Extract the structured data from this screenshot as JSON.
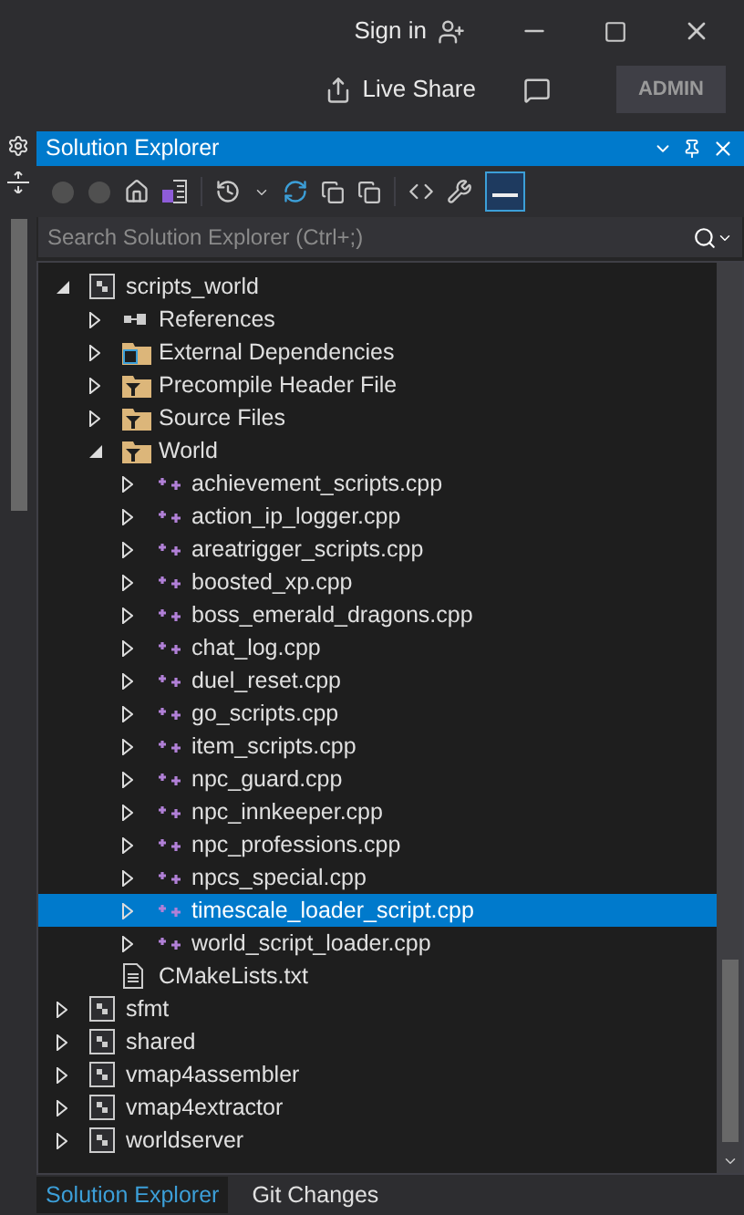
{
  "title_bar": {
    "sign_in": "Sign in",
    "live_share": "Live Share",
    "badge": "ADMIN"
  },
  "panel": {
    "title": "Solution Explorer",
    "search": {
      "placeholder": "Search Solution Explorer (Ctrl+;)"
    }
  },
  "tree": [
    {
      "label": "scripts_world",
      "kind": "project",
      "expanded": true,
      "selected": false,
      "children": [
        {
          "label": "References",
          "kind": "references",
          "expanded": false,
          "selected": false
        },
        {
          "label": "External Dependencies",
          "kind": "external",
          "expanded": false,
          "selected": false
        },
        {
          "label": "Precompile Header File",
          "kind": "filter",
          "expanded": false,
          "selected": false
        },
        {
          "label": "Source Files",
          "kind": "filter",
          "expanded": false,
          "selected": false
        },
        {
          "label": "World",
          "kind": "filter",
          "expanded": true,
          "selected": false,
          "children": [
            {
              "label": "achievement_scripts.cpp",
              "kind": "cpp",
              "expanded": false,
              "selected": false
            },
            {
              "label": "action_ip_logger.cpp",
              "kind": "cpp",
              "expanded": false,
              "selected": false
            },
            {
              "label": "areatrigger_scripts.cpp",
              "kind": "cpp",
              "expanded": false,
              "selected": false
            },
            {
              "label": "boosted_xp.cpp",
              "kind": "cpp",
              "expanded": false,
              "selected": false
            },
            {
              "label": "boss_emerald_dragons.cpp",
              "kind": "cpp",
              "expanded": false,
              "selected": false
            },
            {
              "label": "chat_log.cpp",
              "kind": "cpp",
              "expanded": false,
              "selected": false
            },
            {
              "label": "duel_reset.cpp",
              "kind": "cpp",
              "expanded": false,
              "selected": false
            },
            {
              "label": "go_scripts.cpp",
              "kind": "cpp",
              "expanded": false,
              "selected": false
            },
            {
              "label": "item_scripts.cpp",
              "kind": "cpp",
              "expanded": false,
              "selected": false
            },
            {
              "label": "npc_guard.cpp",
              "kind": "cpp",
              "expanded": false,
              "selected": false
            },
            {
              "label": "npc_innkeeper.cpp",
              "kind": "cpp",
              "expanded": false,
              "selected": false
            },
            {
              "label": "npc_professions.cpp",
              "kind": "cpp",
              "expanded": false,
              "selected": false
            },
            {
              "label": "npcs_special.cpp",
              "kind": "cpp",
              "expanded": false,
              "selected": false
            },
            {
              "label": "timescale_loader_script.cpp",
              "kind": "cpp",
              "expanded": false,
              "selected": true
            },
            {
              "label": "world_script_loader.cpp",
              "kind": "cpp",
              "expanded": false,
              "selected": false
            }
          ]
        },
        {
          "label": "CMakeLists.txt",
          "kind": "txt",
          "selected": false
        }
      ]
    },
    {
      "label": "sfmt",
      "kind": "project",
      "expanded": false,
      "selected": false
    },
    {
      "label": "shared",
      "kind": "project",
      "expanded": false,
      "selected": false
    },
    {
      "label": "vmap4assembler",
      "kind": "project",
      "expanded": false,
      "selected": false
    },
    {
      "label": "vmap4extractor",
      "kind": "project",
      "expanded": false,
      "selected": false
    },
    {
      "label": "worldserver",
      "kind": "project",
      "expanded": false,
      "selected": false
    }
  ],
  "bottom_tabs": [
    {
      "label": "Solution Explorer",
      "selected": true
    },
    {
      "label": "Git Changes",
      "selected": false
    }
  ]
}
